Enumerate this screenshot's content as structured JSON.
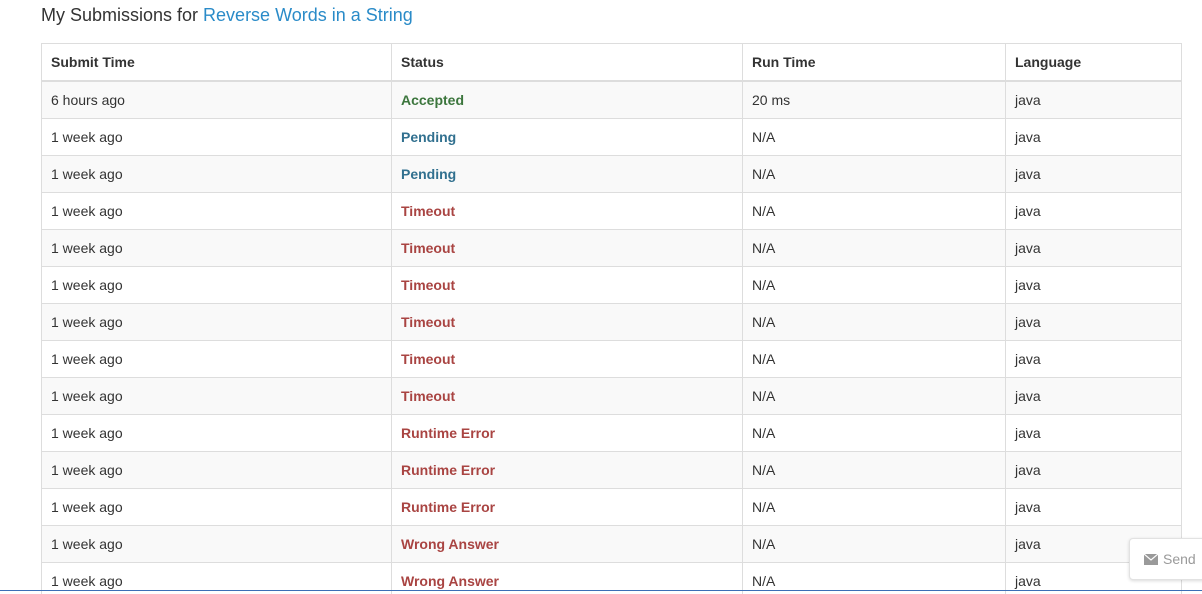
{
  "header": {
    "prefix": "My Submissions for ",
    "problem_link": "Reverse Words in a String"
  },
  "table": {
    "columns": [
      "Submit Time",
      "Status",
      "Run Time",
      "Language"
    ],
    "rows": [
      {
        "submit_time": "6 hours ago",
        "status": "Accepted",
        "run_time": "20 ms",
        "language": "java"
      },
      {
        "submit_time": "1 week ago",
        "status": "Pending",
        "run_time": "N/A",
        "language": "java"
      },
      {
        "submit_time": "1 week ago",
        "status": "Pending",
        "run_time": "N/A",
        "language": "java"
      },
      {
        "submit_time": "1 week ago",
        "status": "Timeout",
        "run_time": "N/A",
        "language": "java"
      },
      {
        "submit_time": "1 week ago",
        "status": "Timeout",
        "run_time": "N/A",
        "language": "java"
      },
      {
        "submit_time": "1 week ago",
        "status": "Timeout",
        "run_time": "N/A",
        "language": "java"
      },
      {
        "submit_time": "1 week ago",
        "status": "Timeout",
        "run_time": "N/A",
        "language": "java"
      },
      {
        "submit_time": "1 week ago",
        "status": "Timeout",
        "run_time": "N/A",
        "language": "java"
      },
      {
        "submit_time": "1 week ago",
        "status": "Timeout",
        "run_time": "N/A",
        "language": "java"
      },
      {
        "submit_time": "1 week ago",
        "status": "Runtime Error",
        "run_time": "N/A",
        "language": "java"
      },
      {
        "submit_time": "1 week ago",
        "status": "Runtime Error",
        "run_time": "N/A",
        "language": "java"
      },
      {
        "submit_time": "1 week ago",
        "status": "Runtime Error",
        "run_time": "N/A",
        "language": "java"
      },
      {
        "submit_time": "1 week ago",
        "status": "Wrong Answer",
        "run_time": "N/A",
        "language": "java"
      },
      {
        "submit_time": "1 week ago",
        "status": "Wrong Answer",
        "run_time": "N/A",
        "language": "java"
      }
    ]
  },
  "send_widget": {
    "label": "Send",
    "icon": "envelope-icon"
  },
  "colors": {
    "link": "#2a8bc8",
    "accepted": "#3c763d",
    "pending": "#31708f",
    "error": "#a94442"
  }
}
